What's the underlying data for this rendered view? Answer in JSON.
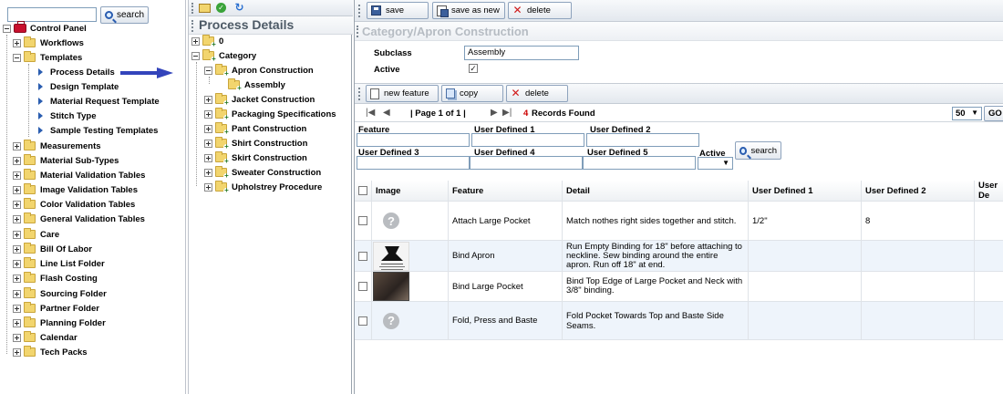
{
  "left_nav": {
    "search_placeholder": "",
    "search_button": "search",
    "root": "Control Panel",
    "items": [
      {
        "label": "Workflows"
      },
      {
        "label": "Templates"
      },
      {
        "label": "Process Details"
      },
      {
        "label": "Design Template"
      },
      {
        "label": "Material Request Template"
      },
      {
        "label": "Stitch Type"
      },
      {
        "label": "Sample Testing Templates"
      },
      {
        "label": "Measurements"
      },
      {
        "label": "Material Sub-Types"
      },
      {
        "label": "Material Validation Tables"
      },
      {
        "label": "Image Validation Tables"
      },
      {
        "label": "Color Validation Tables"
      },
      {
        "label": "General Validation Tables"
      },
      {
        "label": "Care"
      },
      {
        "label": "Bill Of Labor"
      },
      {
        "label": "Line List Folder"
      },
      {
        "label": "Flash Costing"
      },
      {
        "label": "Sourcing Folder"
      },
      {
        "label": "Partner Folder"
      },
      {
        "label": "Planning Folder"
      },
      {
        "label": "Calendar"
      },
      {
        "label": "Tech Packs"
      }
    ]
  },
  "process_tree": {
    "title": "Process Details",
    "items": [
      {
        "label": "0"
      },
      {
        "label": "Category"
      },
      {
        "label": "Apron Construction"
      },
      {
        "label": "Assembly"
      },
      {
        "label": "Jacket Construction"
      },
      {
        "label": "Packaging Specifications"
      },
      {
        "label": "Pant Construction"
      },
      {
        "label": "Shirt Construction"
      },
      {
        "label": "Skirt Construction"
      },
      {
        "label": "Sweater Construction"
      },
      {
        "label": "Upholstrey Procedure"
      }
    ]
  },
  "toolbar": {
    "save": "save",
    "save_as_new": "save as new",
    "delete": "delete"
  },
  "section": {
    "title": "Category/Apron Construction",
    "subclass_label": "Subclass",
    "subclass_value": "Assembly",
    "active_label": "Active",
    "active_checked": true
  },
  "feature_toolbar": {
    "new_feature": "new feature",
    "copy": "copy",
    "delete": "delete"
  },
  "pager": {
    "page_text": "| Page 1 of 1 |",
    "records_count": "4",
    "records_text": "Records Found",
    "page_size": "50",
    "go_label": "GO"
  },
  "filters": {
    "feature": "Feature",
    "ud1": "User Defined 1",
    "ud2": "User Defined 2",
    "ud3": "User Defined 3",
    "ud4": "User Defined 4",
    "ud5": "User Defined 5",
    "active": "Active",
    "search_button": "search"
  },
  "grid": {
    "headers": {
      "image": "Image",
      "feature": "Feature",
      "detail": "Detail",
      "ud1": "User Defined 1",
      "ud2": "User Defined 2",
      "ud3": "User De"
    },
    "rows": [
      {
        "feature": "Attach Large Pocket",
        "detail": "Match nothes right sides together and stitch.",
        "ud1": "1/2\"",
        "ud2": "8"
      },
      {
        "feature": "Bind Apron",
        "detail": "Run Empty Binding for 18\" before attaching to neckline. Sew binding around the entire apron. Run off 18\" at end.",
        "ud1": "",
        "ud2": ""
      },
      {
        "feature": "Bind Large Pocket",
        "detail": "Bind Top Edge of Large Pocket and Neck with 3/8\" binding.",
        "ud1": "",
        "ud2": ""
      },
      {
        "feature": "Fold, Press and Baste",
        "detail": "Fold Pocket Towards Top and Baste Side Seams.",
        "ud1": "",
        "ud2": ""
      }
    ]
  },
  "colors": {
    "accent": "#2a5db0",
    "records_count": "#cc0000",
    "arrow": "#3344bb"
  }
}
